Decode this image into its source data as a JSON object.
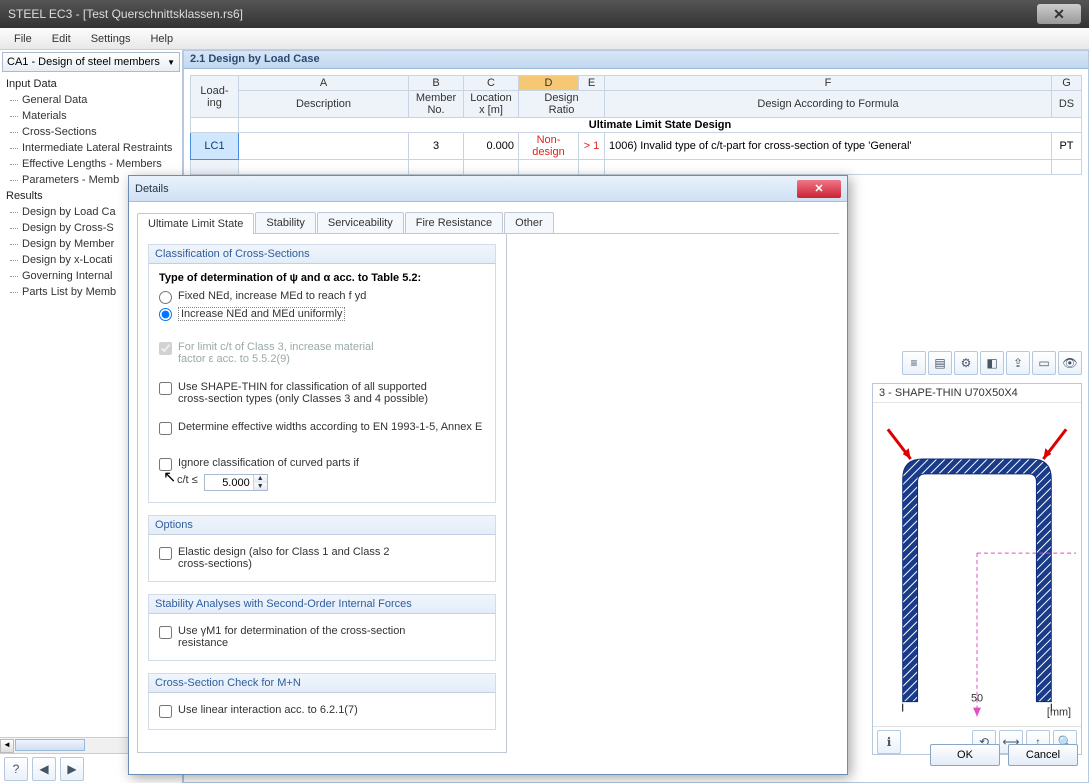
{
  "titlebar": {
    "title": "STEEL EC3 - [Test Querschnittsklassen.rs6]"
  },
  "menubar": {
    "items": [
      "File",
      "Edit",
      "Settings",
      "Help"
    ]
  },
  "sidebar": {
    "dropdown": "CA1 - Design of steel members",
    "input_data_label": "Input Data",
    "input_children": [
      "General Data",
      "Materials",
      "Cross-Sections",
      "Intermediate Lateral Restraints",
      "Effective Lengths - Members",
      "Parameters - Memb"
    ],
    "results_label": "Results",
    "results_children": [
      "Design by Load Ca",
      "Design by Cross-S",
      "Design by Member",
      "Design by x-Locati",
      "Governing Internal",
      "Parts List by Memb"
    ]
  },
  "main": {
    "header": "2.1 Design by Load Case",
    "cols_top": {
      "loading": "Load-\ning",
      "A": "A",
      "B": "B",
      "C": "C",
      "D": "D",
      "E": "E",
      "F": "F",
      "G": "G"
    },
    "cols_bot": {
      "desc": "Description",
      "member": "Member\nNo.",
      "loc": "Location\nx [m]",
      "ratio": "Design\nRatio",
      "formula": "Design According to Formula",
      "ds": "DS"
    },
    "section_row": "Ultimate Limit State Design",
    "row1": {
      "lc": "LC1",
      "member": "3",
      "loc": "0.000",
      "ratio": "Non-design",
      "gt": "> 1",
      "formula": "1006) Invalid type of c/t-part for cross-section of type 'General'",
      "ds": "PT"
    }
  },
  "dialog": {
    "title": "Details",
    "tabs": [
      "Ultimate Limit State",
      "Stability",
      "Serviceability",
      "Fire Resistance",
      "Other"
    ],
    "g1_header": "Classification of Cross-Sections",
    "g1_bold": "Type of determination of ψ and α acc. to Table 5.2:",
    "g1_radio1": "Fixed NEd, increase MEd to reach f yd",
    "g1_radio2": "Increase NEd and MEd uniformly",
    "g1_chk1a": "For limit c/t of Class 3, increase material",
    "g1_chk1b": "factor ε acc. to 5.5.2(9)",
    "g1_chk2a": "Use SHAPE-THIN for classification of all supported",
    "g1_chk2b": "cross-section types (only Classes 3 and 4 possible)",
    "g1_chk3": "Determine effective widths according to EN 1993-1-5, Annex E",
    "g1_chk4": "Ignore classification of curved parts if",
    "g1_ct_label": "c/t ≤",
    "g1_ct_val": "5.000",
    "g2_header": "Options",
    "g2_chk1a": "Elastic design (also for Class 1 and Class 2",
    "g2_chk1b": "cross-sections)",
    "g3_header": "Stability Analyses with Second-Order Internal Forces",
    "g3_chk1a": "Use γM1 for determination of the cross-section",
    "g3_chk1b": "resistance",
    "g4_header": "Cross-Section Check for M+N",
    "g4_chk1": "Use linear interaction acc. to 6.2.1(7)"
  },
  "shape": {
    "title": "3 - SHAPE-THIN U70X50X4",
    "dim": "50",
    "unit": "[mm]"
  },
  "buttons": {
    "ok": "OK",
    "cancel": "Cancel"
  }
}
